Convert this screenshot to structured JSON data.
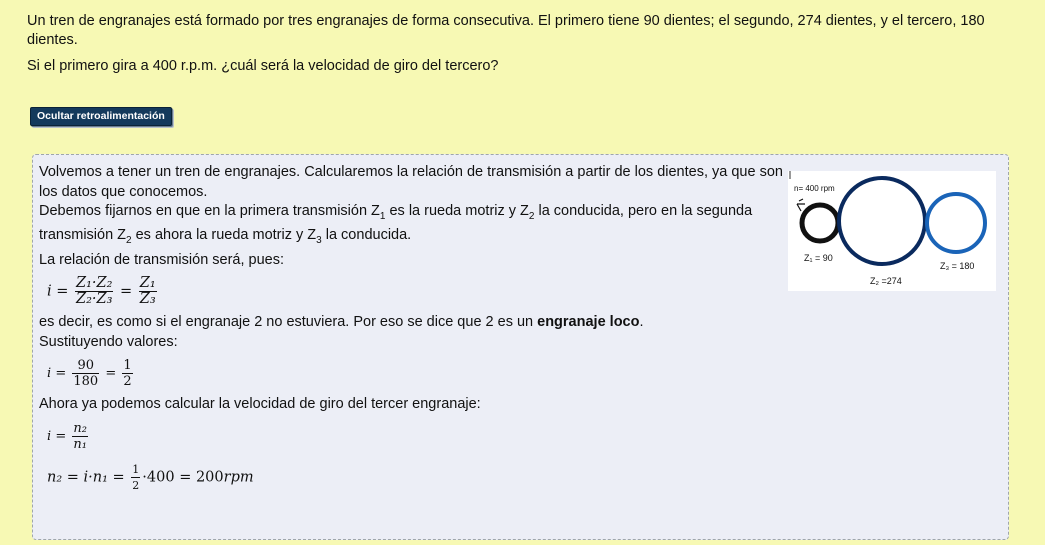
{
  "question": {
    "line1": "Un tren de engranajes está formado por tres engranajes de forma consecutiva. El primero tiene 90 dientes; el segundo, 274 dientes, y el tercero, 180 dientes.",
    "line2": "Si el primero gira a 400 r.p.m. ¿cuál será la velocidad de giro del tercero?"
  },
  "toggle_button": {
    "label": "Ocultar retroalimentación"
  },
  "feedback": {
    "p1": "Volvemos a tener un tren de engranajes.  Calcularemos la relación de transmisión a partir de los dientes, ya que son los datos que conocemos.",
    "p2_a": "Debemos fijarnos en que en la primera transmisión  Z",
    "p2_b": " es  la rueda motriz y Z",
    "p2_c": " la conducida, pero en la segunda transmisión  Z",
    "p2_d": " es ahora la rueda motriz y Z",
    "p2_e": " la conducida.",
    "p3": "La relación de transmisión será, pues:",
    "p4_a": "es decir, es como si el engranaje 2 no estuviera. Por eso se dice que 2 es un ",
    "p4_bold": "engranaje loco",
    "p4_end": ".",
    "p5": "Sustituyendo valores:",
    "p6": "Ahora ya podemos calcular la velocidad de giro del tercer engranaje:",
    "sub1": "1",
    "sub2": "2",
    "sub3": "3",
    "formula1": {
      "i": "i",
      "eq": "=",
      "num1": "Z₁·Z₂",
      "den1": "Z₂·Z₃",
      "num2": "Z₁",
      "den2": "Z₃"
    },
    "formula2": {
      "i": "i",
      "eq": "=",
      "num1": "90",
      "den1": "180",
      "num2": "1",
      "den2": "2"
    },
    "formula3": {
      "i": "i",
      "eq": "=",
      "num": "n₂",
      "den": "n₁"
    },
    "formula4": {
      "lhs": "n₂",
      "mid": "= i·n₁ =",
      "num": "1",
      "den": "2",
      "tail": "·400 = 200",
      "unit": "rpm"
    }
  },
  "figure": {
    "rpm_label": "n= 400 rpm",
    "z1_label": "Z₁ = 90",
    "z2_label": "Z₂ =274",
    "z3_label": "Z₃ = 180",
    "colors": {
      "z1": "#111111",
      "z2": "#0a2a5e",
      "z3": "#1a64b8"
    }
  }
}
